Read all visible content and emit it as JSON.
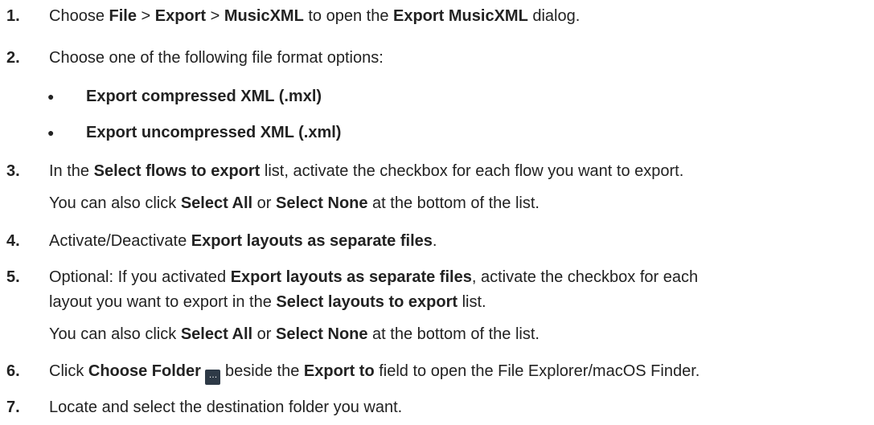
{
  "steps": [
    {
      "number": "1.",
      "t1": "Choose ",
      "b1": "File",
      "t2": " > ",
      "b2": "Export",
      "t3": " > ",
      "b3": "MusicXML",
      "t4": " to open the ",
      "b4": "Export MusicXML",
      "t5": " dialog."
    },
    {
      "number": "2.",
      "text": "Choose one of the following file format options:",
      "options": [
        "Export compressed XML (.mxl)",
        "Export uncompressed XML (.xml)"
      ]
    },
    {
      "number": "3.",
      "t1": "In the ",
      "b1": "Select flows to export",
      "t2": " list, activate the checkbox for each flow you want to export.",
      "note_t1": "You can also click ",
      "note_b1": "Select All",
      "note_t2": " or ",
      "note_b2": "Select None",
      "note_t3": " at the bottom of the list."
    },
    {
      "number": "4.",
      "t1": "Activate/Deactivate ",
      "b1": "Export layouts as separate files",
      "t2": "."
    },
    {
      "number": "5.",
      "t1": "Optional: If you activated ",
      "b1": "Export layouts as separate files",
      "t2": ", activate the checkbox for each",
      "t3": "layout you want to export in the ",
      "b2": "Select layouts to export",
      "t4": " list.",
      "note_t1": "You can also click ",
      "note_b1": "Select All",
      "note_t2": " or ",
      "note_b2": "Select None",
      "note_t3": " at the bottom of the list."
    },
    {
      "number": "6.",
      "t1": "Click ",
      "b1": "Choose Folder",
      "button_glyph": "…",
      "t2": " beside the ",
      "b2": "Export to",
      "t3": " field to open the File Explorer/macOS Finder."
    },
    {
      "number": "7.",
      "text": "Locate and select the destination folder you want."
    }
  ]
}
